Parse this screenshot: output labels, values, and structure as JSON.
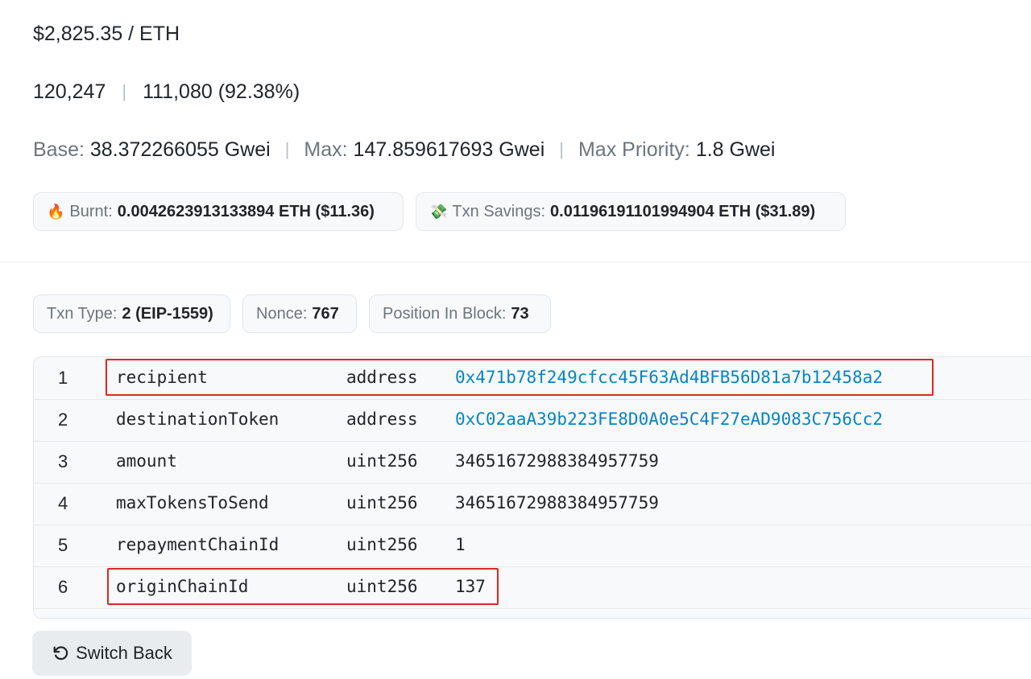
{
  "price": {
    "value": "$2,825.35 / ETH"
  },
  "gas": {
    "limit": "120,247",
    "separator": "|",
    "used": "111,080 (92.38%)"
  },
  "fees": {
    "base_label": "Base:",
    "base_value": "38.372266055 Gwei",
    "max_label": "Max:",
    "max_value": "147.859617693 Gwei",
    "priority_label": "Max Priority:",
    "priority_value": "1.8 Gwei",
    "separator": "|"
  },
  "badges": {
    "burnt": {
      "icon": "fire-icon",
      "emoji": "🔥",
      "label": "Burnt:",
      "value": "0.0042623913133894 ETH ($11.36)"
    },
    "savings": {
      "icon": "money-with-wings-icon",
      "emoji": "💸",
      "label": "Txn Savings:",
      "value": "0.01196191101994904 ETH ($31.89)"
    }
  },
  "attributes": {
    "txn_type": {
      "label": "Txn Type:",
      "value": "2 (EIP-1559)"
    },
    "nonce": {
      "label": "Nonce:",
      "value": "767"
    },
    "position": {
      "label": "Position In Block:",
      "value": "73"
    }
  },
  "params": {
    "rows": [
      {
        "index": "1",
        "name": "recipient",
        "type": "address",
        "value": "0x471b78f249cfcc45F63Ad4BFB56D81a7b12458a2",
        "is_link": true,
        "highlighted": true
      },
      {
        "index": "2",
        "name": "destinationToken",
        "type": "address",
        "value": "0xC02aaA39b223FE8D0A0e5C4F27eAD9083C756Cc2",
        "is_link": true,
        "highlighted": false
      },
      {
        "index": "3",
        "name": "amount",
        "type": "uint256",
        "value": "34651672988384957759",
        "is_link": false,
        "highlighted": false
      },
      {
        "index": "4",
        "name": "maxTokensToSend",
        "type": "uint256",
        "value": "34651672988384957759",
        "is_link": false,
        "highlighted": false
      },
      {
        "index": "5",
        "name": "repaymentChainId",
        "type": "uint256",
        "value": "1",
        "is_link": false,
        "highlighted": false
      },
      {
        "index": "6",
        "name": "originChainId",
        "type": "uint256",
        "value": "137",
        "is_link": false,
        "highlighted": true
      }
    ]
  },
  "actions": {
    "switch_back_icon": "undo-icon",
    "switch_back_label": "Switch Back"
  },
  "colors": {
    "link": "#0784c3",
    "highlight": "#e0281c",
    "muted_text": "#6c757d"
  }
}
